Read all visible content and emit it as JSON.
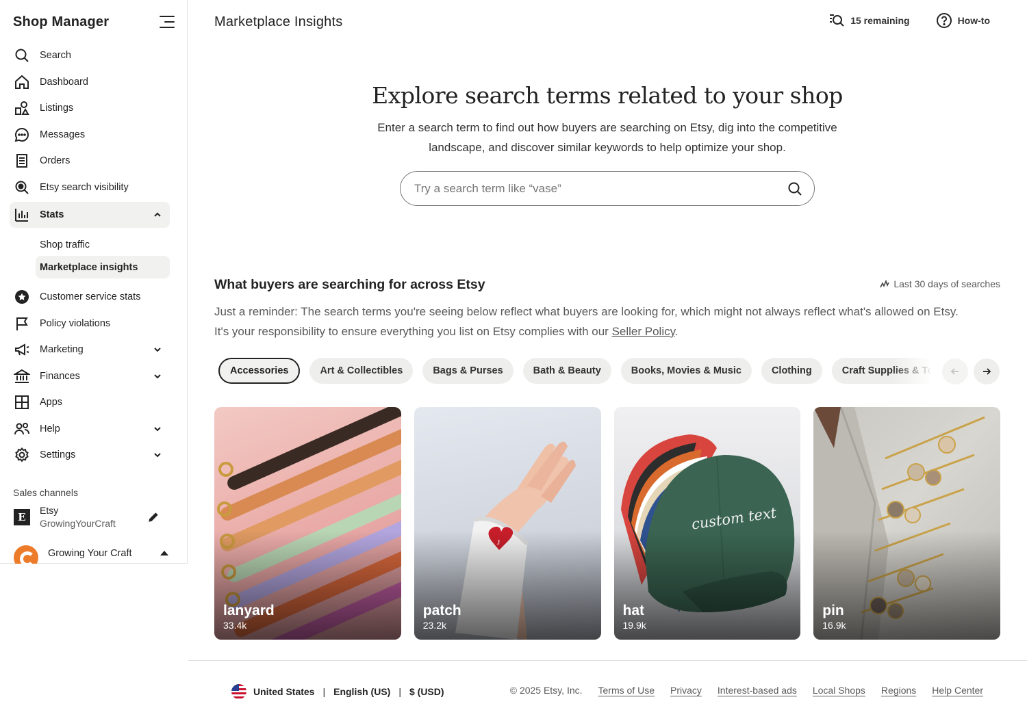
{
  "sidebar": {
    "title": "Shop Manager",
    "nav": [
      {
        "label": "Search"
      },
      {
        "label": "Dashboard"
      },
      {
        "label": "Listings"
      },
      {
        "label": "Messages"
      },
      {
        "label": "Orders"
      },
      {
        "label": "Etsy search visibility"
      },
      {
        "label": "Stats"
      }
    ],
    "stats_sub": [
      {
        "label": "Shop traffic"
      },
      {
        "label": "Marketplace insights"
      }
    ],
    "nav2": [
      {
        "label": "Customer service stats"
      },
      {
        "label": "Policy violations"
      },
      {
        "label": "Marketing"
      },
      {
        "label": "Finances"
      },
      {
        "label": "Apps"
      },
      {
        "label": "Help"
      },
      {
        "label": "Settings"
      }
    ],
    "sales_channels": {
      "heading": "Sales channels",
      "etsy_name": "Etsy",
      "etsy_logo": "E",
      "shop_handle": "GrowingYourCraft",
      "shop_name": "Growing Your Craft"
    }
  },
  "header": {
    "title": "Marketplace Insights",
    "remaining": "15 remaining",
    "howto": "How-to"
  },
  "hero": {
    "title": "Explore search terms related to your shop",
    "description": "Enter a search term to find out how buyers are searching on Etsy, dig into the competitive landscape, and discover similar keywords to help optimize your shop.",
    "search_placeholder": "Try a search term like “vase”"
  },
  "section": {
    "title": "What buyers are searching for across Etsy",
    "note": "Last 30 days of searches",
    "description_before": "Just a reminder: The search terms you're seeing below reflect what buyers are looking for, which might not always reflect what's allowed on Etsy. It's your responsibility to ensure everything you list on Etsy complies with our ",
    "policy_link": "Seller Policy",
    "description_after": "."
  },
  "categories": [
    {
      "label": "Accessories",
      "selected": true
    },
    {
      "label": "Art & Collectibles"
    },
    {
      "label": "Bags & Purses"
    },
    {
      "label": "Bath & Beauty"
    },
    {
      "label": "Books, Movies & Music"
    },
    {
      "label": "Clothing"
    },
    {
      "label": "Craft Supplies & Tools"
    }
  ],
  "cards": [
    {
      "term": "lanyard",
      "count": "33.4k"
    },
    {
      "term": "patch",
      "count": "23.2k",
      "patch_letter": "J"
    },
    {
      "term": "hat",
      "count": "19.9k",
      "embroidery": "custom text"
    },
    {
      "term": "pin",
      "count": "16.9k"
    }
  ],
  "footer": {
    "region": "United States",
    "language": "English (US)",
    "currency": "$ (USD)",
    "copyright": "© 2025 Etsy, Inc.",
    "links": [
      "Terms of Use",
      "Privacy",
      "Interest-based ads",
      "Local Shops",
      "Regions",
      "Help Center"
    ]
  },
  "colors": {
    "text": "#222222",
    "muted": "#595959",
    "chip_bg": "#eeeeec",
    "active_bg": "#f1f1ef",
    "border": "#e1e3df"
  },
  "icons": [
    "menu-icon",
    "search-icon",
    "home-icon",
    "listings-icon",
    "messages-icon",
    "orders-icon",
    "search-visibility-icon",
    "stats-icon",
    "star-badge-icon",
    "flag-icon",
    "megaphone-icon",
    "bank-icon",
    "apps-grid-icon",
    "people-icon",
    "gear-icon",
    "chevron-up-icon",
    "chevron-down-icon",
    "pencil-icon",
    "help-circle-icon",
    "trend-icon",
    "arrow-left-icon",
    "arrow-right-icon"
  ]
}
